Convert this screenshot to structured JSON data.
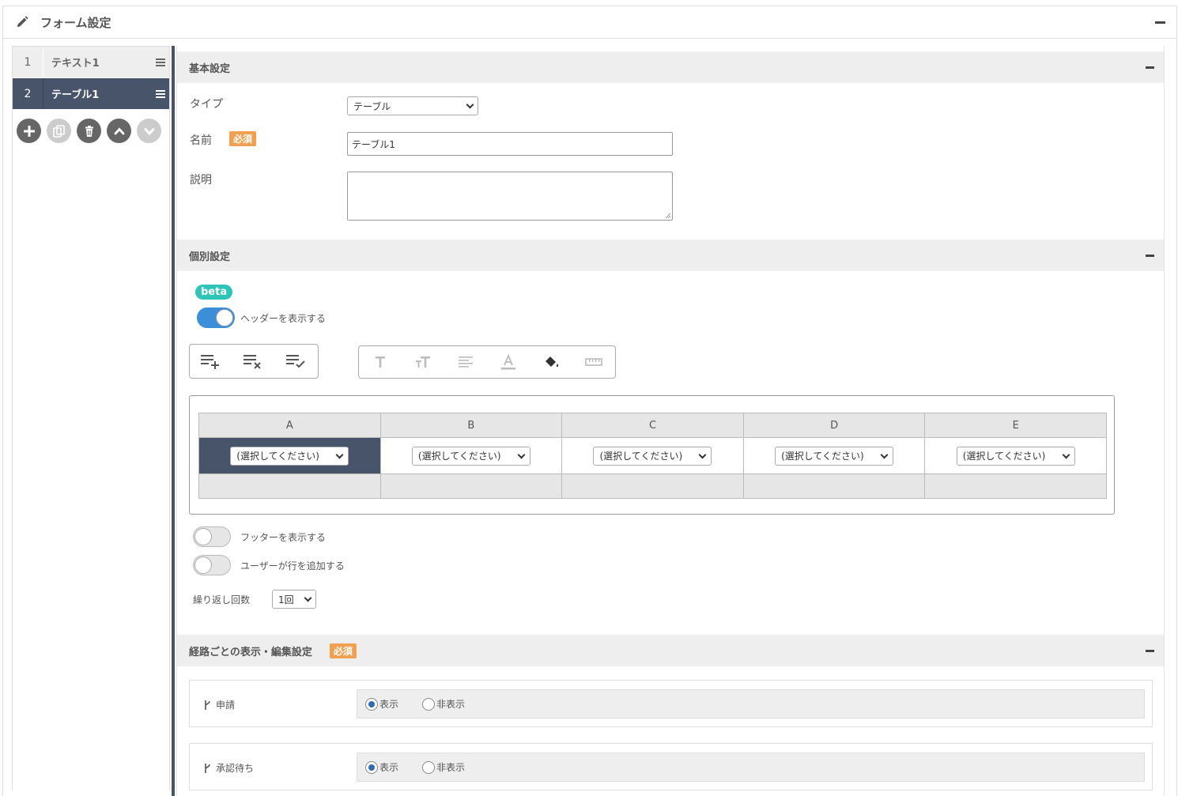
{
  "header": {
    "title": "フォーム設定"
  },
  "sidebar": {
    "items": [
      {
        "num": "1",
        "label": "テキスト1"
      },
      {
        "num": "2",
        "label": "テーブル1"
      }
    ],
    "actions": [
      "add-icon",
      "copy-icon",
      "trash-icon",
      "chevron-up-icon",
      "chevron-down-icon"
    ]
  },
  "basic": {
    "section_title": "基本設定",
    "type_label": "タイプ",
    "type_value": "テーブル",
    "name_label": "名前",
    "required": "必須",
    "name_value": "テーブル1",
    "desc_label": "説明",
    "desc_value": ""
  },
  "individual": {
    "section_title": "個別設定",
    "beta": "beta",
    "header_toggle_label": "ヘッダーを表示する",
    "header_toggle_on": true,
    "footer_toggle_label": "フッターを表示する",
    "user_add_row_label": "ユーザーが行を追加する",
    "repeat_label": "繰り返し回数",
    "repeat_value": "1回"
  },
  "table": {
    "columns": [
      "A",
      "B",
      "C",
      "D",
      "E"
    ],
    "cell_select": "(選択してください)"
  },
  "routes": {
    "section_title": "経路ごとの表示・編集設定",
    "required": "必須",
    "items": [
      {
        "label": "申請",
        "show": "表示",
        "hide": "非表示",
        "selected": "show"
      },
      {
        "label": "承認待ち",
        "show": "表示",
        "hide": "非表示",
        "selected": "show"
      }
    ]
  },
  "colors": {
    "nav_active": "#48546a",
    "beta": "#2ec4b6",
    "required": "#f0a050",
    "toggle_on": "#3a8fd8"
  }
}
